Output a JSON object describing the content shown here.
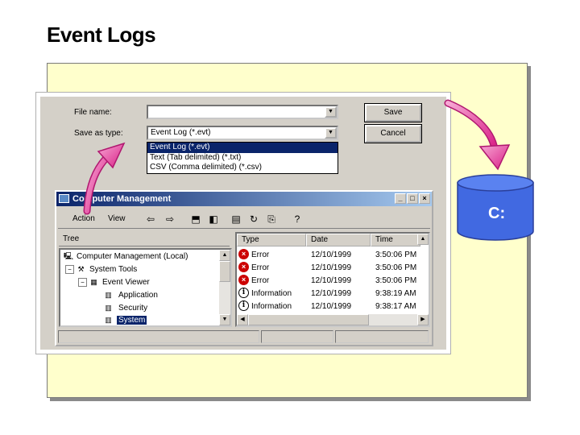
{
  "slide": {
    "title": "Event Logs"
  },
  "save_dialog": {
    "file_name_label": "File name:",
    "file_name_value": "",
    "save_as_type_label": "Save as type:",
    "save_as_type_value": "Event Log (*.evt)",
    "save_label": "Save",
    "cancel_label": "Cancel",
    "type_options": [
      "Event Log (*.evt)",
      "Text (Tab delimited) (*.txt)",
      "CSV (Comma delimited) (*.csv)"
    ]
  },
  "mgmt_window": {
    "title": "Computer Management",
    "menu": {
      "action": "Action",
      "view": "View"
    },
    "tree_tab": "Tree",
    "tree": {
      "root": "Computer Management (Local)",
      "system_tools": "System Tools",
      "event_viewer": "Event Viewer",
      "application": "Application",
      "security": "Security",
      "system": "System"
    },
    "columns": {
      "type": "Type",
      "date": "Date",
      "time": "Time"
    },
    "rows": [
      {
        "type": "Error",
        "date": "12/10/1999",
        "time": "3:50:06 PM",
        "icon": "error-icon"
      },
      {
        "type": "Error",
        "date": "12/10/1999",
        "time": "3:50:06 PM",
        "icon": "error-icon"
      },
      {
        "type": "Error",
        "date": "12/10/1999",
        "time": "3:50:06 PM",
        "icon": "error-icon"
      },
      {
        "type": "Information",
        "date": "12/10/1999",
        "time": "9:38:19 AM",
        "icon": "information-icon"
      },
      {
        "type": "Information",
        "date": "12/10/1999",
        "time": "9:38:17 AM",
        "icon": "information-icon"
      }
    ]
  },
  "disk": {
    "label": "C:"
  },
  "colors": {
    "panel": "#ffffcc",
    "arrow": "#e0409a",
    "disk": "#4169e1",
    "selection": "#0a246a"
  }
}
